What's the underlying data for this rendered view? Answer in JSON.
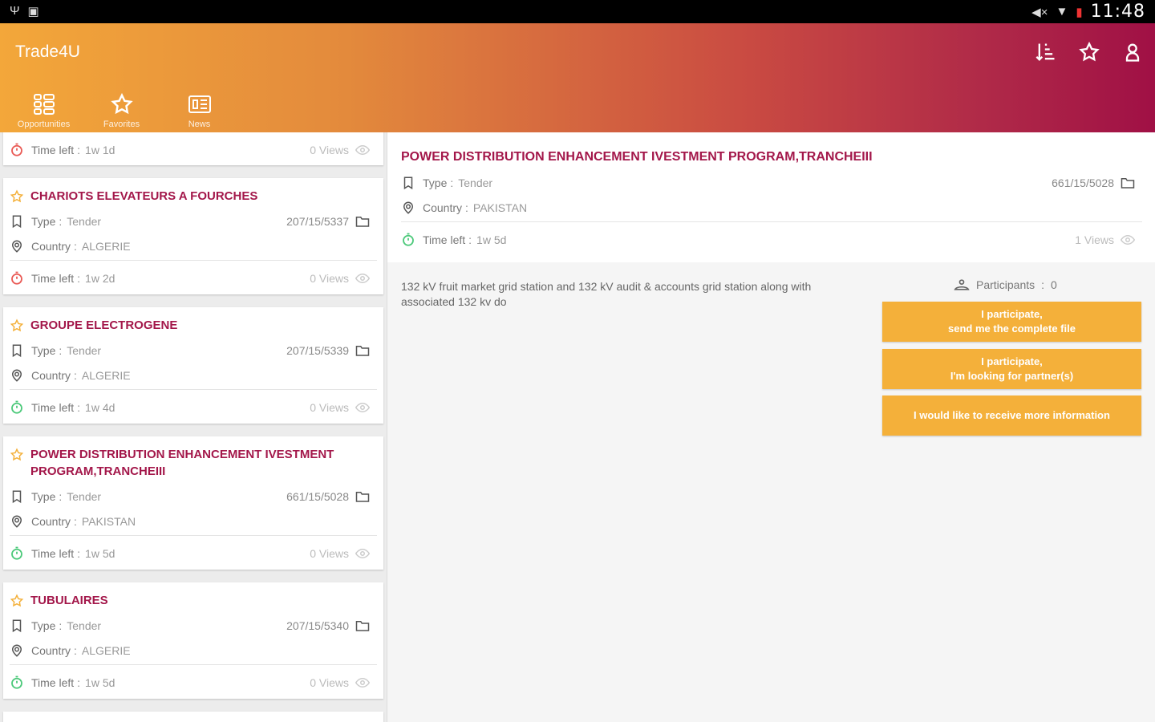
{
  "status_bar": {
    "time": "11:48"
  },
  "app": {
    "title": "Trade4U"
  },
  "tabs": [
    {
      "label": "Opportunities",
      "icon": "grid-list-icon"
    },
    {
      "label": "Favorites",
      "icon": "star-icon"
    },
    {
      "label": "News",
      "icon": "newspaper-icon"
    }
  ],
  "labels": {
    "type": "Type",
    "country": "Country",
    "time_left": "Time left",
    "sep": ":",
    "participants": "Participants",
    "participants_count": "0"
  },
  "list": {
    "partial_top": {
      "time_left": "1w 1d",
      "views": "0 Views"
    },
    "cards": [
      {
        "title": "CHARIOTS ELEVATEURS A FOURCHES",
        "type": "Tender",
        "ref": "207/15/5337",
        "country": "ALGERIE",
        "time_left": "1w 2d",
        "views": "0 Views",
        "status": "red"
      },
      {
        "title": "GROUPE ELECTROGENE",
        "type": "Tender",
        "ref": "207/15/5339",
        "country": "ALGERIE",
        "time_left": "1w 4d",
        "views": "0 Views",
        "status": "green"
      },
      {
        "title": "POWER DISTRIBUTION ENHANCEMENT IVESTMENT PROGRAM,TRANCHEIII",
        "type": "Tender",
        "ref": "661/15/5028",
        "country": "PAKISTAN",
        "time_left": "1w 5d",
        "views": "0 Views",
        "status": "green"
      },
      {
        "title": "TUBULAIRES",
        "type": "Tender",
        "ref": "207/15/5340",
        "country": "ALGERIE",
        "time_left": "1w 5d",
        "views": "0 Views",
        "status": "green"
      }
    ]
  },
  "detail": {
    "title": "POWER DISTRIBUTION ENHANCEMENT IVESTMENT PROGRAM,TRANCHEIII",
    "type": "Tender",
    "ref": "661/15/5028",
    "country": "PAKISTAN",
    "time_left": "1w 5d",
    "views": "1 Views",
    "description": "132 kV fruit market grid station and 132 kV audit & accounts grid station along with associated 132 kv do",
    "buttons": [
      {
        "line1": "I participate,",
        "line2": "send me the complete file"
      },
      {
        "line1": "I participate,",
        "line2": "I'm looking for partner(s)"
      },
      {
        "line1": "I would like to receive more information",
        "line2": ""
      }
    ]
  },
  "colors": {
    "accent": "#a3174a",
    "button": "#f4b03a",
    "red": "#e95a55",
    "green": "#4cc97a",
    "gradient_start": "#f3a73a",
    "gradient_end": "#a01045"
  }
}
